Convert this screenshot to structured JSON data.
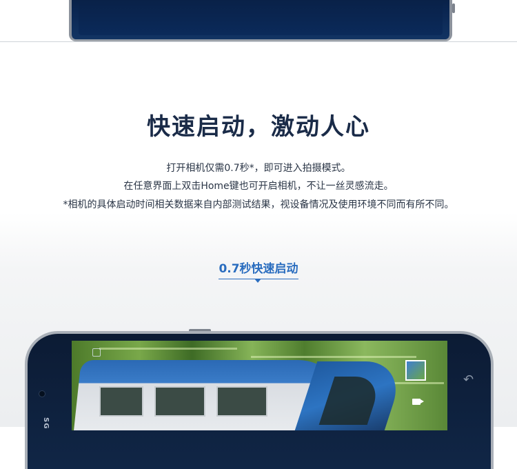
{
  "headline": "快速启动，激动人心",
  "description": {
    "line1": "打开相机仅需0.7秒*，即可进入拍摄模式。",
    "line2": "在任意界面上双击Home键也可开启相机，不让一丝灵感流走。",
    "line3": "*相机的具体启动时间相关数据来自内部测试结果，视设备情况及使用环境不同而有所不同。"
  },
  "badge": {
    "label": "0.7秒快速启动"
  },
  "phone": {
    "brand": "SG"
  },
  "colors": {
    "headline": "#1a2b48",
    "accent": "#2a6dbf",
    "body_text": "#2a3546",
    "phone_body": "#0c1b34"
  },
  "icons": [
    "back-icon",
    "video-camera-icon",
    "gallery-thumbnail-icon",
    "camera-settings-icon"
  ]
}
